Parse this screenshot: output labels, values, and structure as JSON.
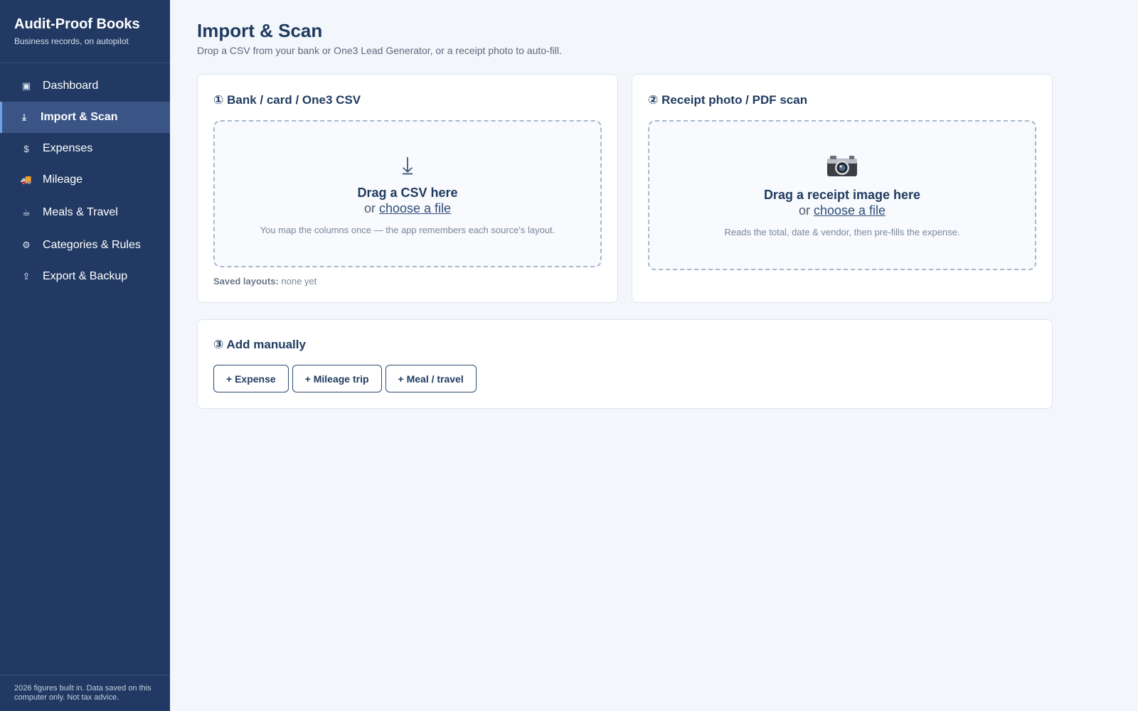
{
  "brand": {
    "title": "Audit-Proof Books",
    "subtitle": "Business records, on autopilot"
  },
  "nav": [
    {
      "label": "Dashboard",
      "icon": "dashboard-icon",
      "glyph": "▣",
      "active": false
    },
    {
      "label": "Import & Scan",
      "icon": "download-icon",
      "glyph": "⤓",
      "active": true
    },
    {
      "label": "Expenses",
      "icon": "dollar-icon",
      "glyph": "$",
      "active": false
    },
    {
      "label": "Mileage",
      "icon": "truck-icon",
      "glyph": "🚚",
      "active": false
    },
    {
      "label": "Meals & Travel",
      "icon": "coffee-icon",
      "glyph": "☕",
      "active": false
    },
    {
      "label": "Categories & Rules",
      "icon": "gear-icon",
      "glyph": "⚙",
      "active": false
    },
    {
      "label": "Export & Backup",
      "icon": "upload-icon",
      "glyph": "⇪",
      "active": false
    }
  ],
  "footer": "2026 figures built in. Data saved on this computer only. Not tax advice.",
  "page": {
    "title": "Import & Scan",
    "subtitle": "Drop a CSV from your bank or One3 Lead Generator, or a receipt photo to auto-fill."
  },
  "csv_card": {
    "title": "① Bank / card / One3 CSV",
    "drop_icon": "⤓",
    "drop_main": "Drag a CSV here",
    "drop_or": "or",
    "drop_link": "choose a file",
    "drop_hint": "You map the columns once — the app remembers each source's layout.",
    "saved_label": "Saved layouts:",
    "saved_value": "none yet"
  },
  "receipt_card": {
    "title": "② Receipt photo / PDF scan",
    "drop_main": "Drag a receipt image here",
    "drop_or": "or",
    "drop_link": "choose a file",
    "drop_hint": "Reads the total, date & vendor, then pre-fills the expense."
  },
  "manual": {
    "title": "③ Add manually",
    "buttons": [
      "+ Expense",
      "+ Mileage trip",
      "+ Meal / travel"
    ]
  },
  "colors": {
    "sidebar": "#223a63",
    "active_nav": "#3a5585",
    "accent": "#6f9fe6",
    "text_primary": "#1f3a5f"
  }
}
